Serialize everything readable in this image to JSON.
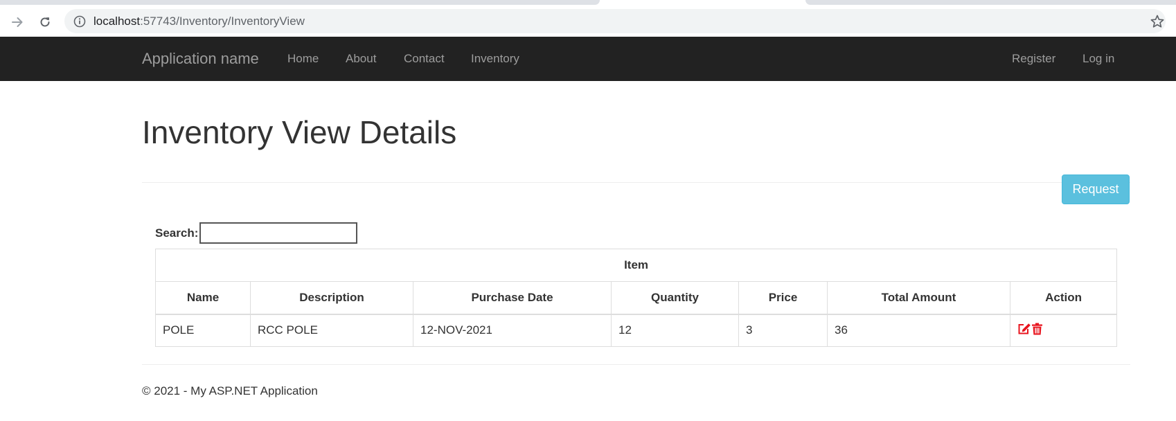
{
  "browser": {
    "url_host": "localhost",
    "url_path": ":57743/Inventory/InventoryView"
  },
  "navbar": {
    "brand": "Application name",
    "links": [
      "Home",
      "About",
      "Contact",
      "Inventory"
    ],
    "right_links": [
      "Register",
      "Log in"
    ]
  },
  "page": {
    "title": "Inventory View Details",
    "request_label": "Request"
  },
  "search": {
    "label": "Search:",
    "value": ""
  },
  "table": {
    "group_header": "Item",
    "columns": [
      "Name",
      "Description",
      "Purchase Date",
      "Quantity",
      "Price",
      "Total Amount",
      "Action"
    ],
    "rows": [
      {
        "name": "POLE",
        "description": "RCC POLE",
        "purchase_date": "12-NOV-2021",
        "quantity": "12",
        "price": "3",
        "total_amount": "36",
        "actions": [
          "edit-icon",
          "delete-icon"
        ]
      }
    ]
  },
  "footer": {
    "text": "© 2021 - My ASP.NET Application"
  },
  "colors": {
    "navbar_bg": "#222222",
    "nav_link": "#9d9d9d",
    "request_button": "#5bc0de",
    "action_icons": "#e8141e"
  }
}
